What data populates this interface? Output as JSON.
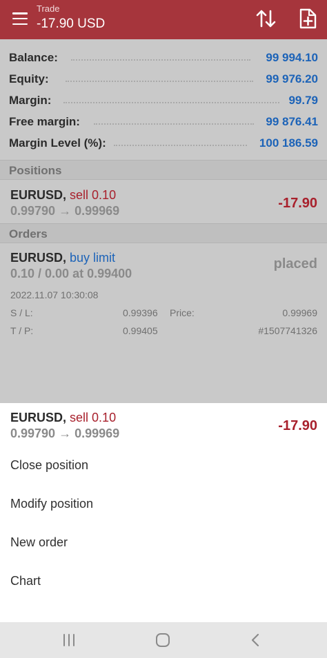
{
  "header": {
    "title_small": "Trade",
    "title_big": "-17.90 USD",
    "icons": [
      "menu-icon",
      "sort-icon",
      "add-document-icon"
    ]
  },
  "summary": [
    {
      "label": "Balance:",
      "value": "99 994.10"
    },
    {
      "label": "Equity:",
      "value": "99 976.20"
    },
    {
      "label": "Margin:",
      "value": "99.79"
    },
    {
      "label": "Free margin:",
      "value": "99 876.41"
    },
    {
      "label": "Margin Level (%):",
      "value": "100 186.59"
    }
  ],
  "positions": {
    "header": "Positions",
    "item": {
      "symbol": "EURUSD,",
      "type": "sell 0.10",
      "prices": "0.99790 → 0.99969",
      "profit": "-17.90"
    }
  },
  "orders": {
    "header": "Orders",
    "item": {
      "symbol": "EURUSD,",
      "type": "buy limit",
      "details": "0.10 / 0.00 at 0.99400",
      "status": "placed",
      "time": "2022.11.07 10:30:08",
      "sl_label": "S / L:",
      "sl_value": "0.99396",
      "price_label": "Price:",
      "price_value": "0.99969",
      "tp_label": "T / P:",
      "tp_value": "0.99405",
      "ticket": "#1507741326"
    }
  },
  "sheet": {
    "symbol": "EURUSD,",
    "type": "sell 0.10",
    "prices": "0.99790 → 0.99969",
    "profit": "-17.90",
    "actions": [
      "Close position",
      "Modify position",
      "New order",
      "Chart"
    ]
  },
  "colors": {
    "header": "#a6353c",
    "value_blue": "#1c63b8",
    "loss_red": "#a8202c",
    "dim_overlay": "#c9c9c9"
  },
  "navbar": {
    "icons": [
      "recent-apps-icon",
      "home-icon",
      "back-icon"
    ]
  }
}
